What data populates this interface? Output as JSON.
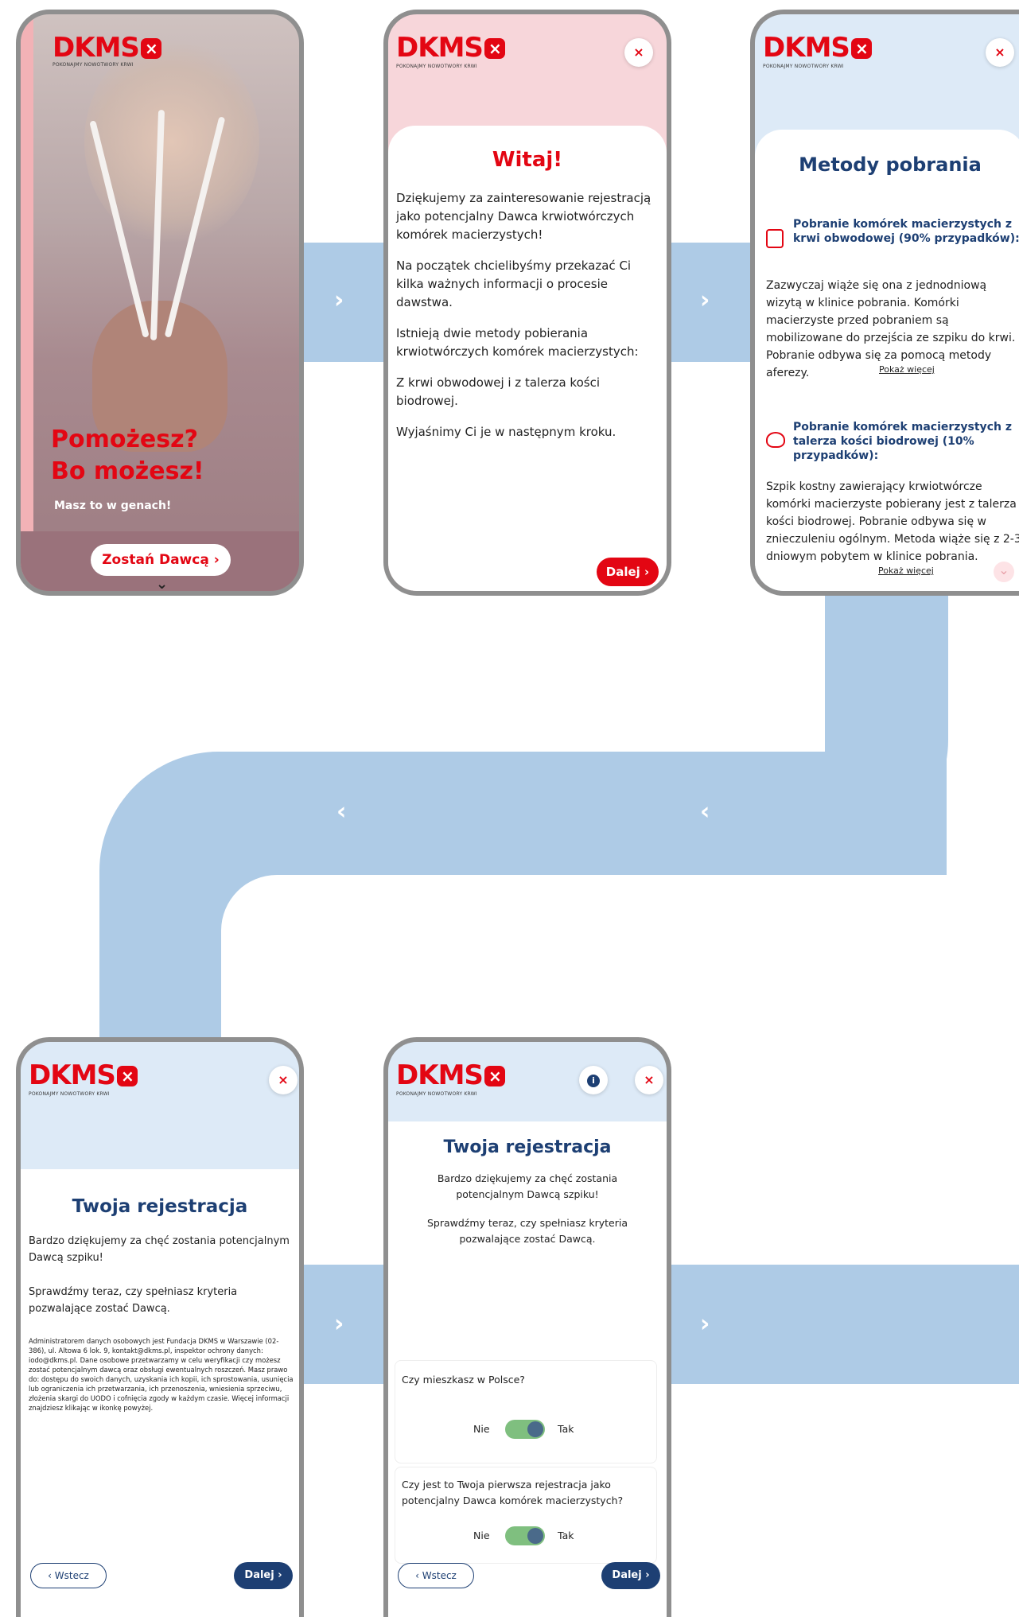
{
  "brand": {
    "logo_text": "DKMS",
    "logo_x": "×",
    "tagline": "POKONAJMY NOWOTWORY KRWI",
    "red": "#e30613",
    "navy": "#1d3f73",
    "flow_blue": "#aecbe6"
  },
  "flow": {
    "next_glyph": "›",
    "prev_glyph": "‹"
  },
  "screen1": {
    "headline": "Pomożesz? Bo możesz!",
    "sub": "Masz to w genach!",
    "cta": "Zostań Dawcą ›",
    "scroll": "⌄"
  },
  "screen2": {
    "close": "×",
    "title": "Witaj!",
    "p1": "Dziękujemy za zainteresowanie rejestracją jako potencjalny Dawca krwiotwórczych komórek macierzystych!",
    "p2": "Na początek chcielibyśmy przekazać Ci kilka ważnych informacji o procesie dawstwa.",
    "p3": "Istnieją dwie metody pobierania krwiotwórczych komórek macierzystych:",
    "p4": "Z krwi obwodowej i z talerza kości biodrowej.",
    "p5": "Wyjaśnimy Ci je w następnym kroku.",
    "next": "Dalej ›"
  },
  "screen3": {
    "close": "×",
    "title": "Metody pobrania",
    "m1_head": "Pobranie komórek macierzystych z krwi obwodowej (90% przypadków):",
    "m1_body": "Zazwyczaj wiąże się ona z jednodniową wizytą w klinice pobrania. Komórki macierzyste przed pobraniem są mobilizowane do przejścia ze szpiku do krwi. Pobranie odbywa się za pomocą metody aferezy.",
    "m1_more": "Pokaż więcej",
    "m2_head": "Pobranie komórek macierzystych z talerza kości biodrowej (10% przypadków):",
    "m2_body": "Szpik kostny zawierający krwiotwórcze komórki macierzyste pobierany jest z talerza kości biodrowej. Pobranie odbywa się w znieczuleniu ogólnym. Metoda wiąże się z 2-3 dniowym pobytem w klinice pobrania.",
    "m2_more": "Pokaż więcej",
    "scroll": "⌄"
  },
  "screen4": {
    "close": "×",
    "title": "Twoja rejestracja",
    "p1": "Bardzo dziękujemy za chęć zostania potencjalnym Dawcą szpiku!",
    "p2": "Sprawdźmy teraz, czy spełniasz kryteria pozwalające zostać Dawcą.",
    "legal": "Administratorem danych osobowych jest Fundacja DKMS w Warszawie (02-386), ul. Altowa 6 lok. 9, kontakt@dkms.pl, inspektor ochrony danych: iodo@dkms.pl. Dane osobowe przetwarzamy w celu weryfikacji czy możesz zostać potencjalnym dawcą oraz obsługi ewentualnych roszczeń. Masz prawo do: dostępu do swoich danych, uzyskania ich kopii, ich sprostowania, usunięcia lub ograniczenia ich przetwarzania, ich przenoszenia, wniesienia sprzeciwu, złożenia skargi do UODO i cofnięcia zgody w każdym czasie. Więcej informacji znajdziesz klikając w ikonkę powyżej.",
    "back": "‹  Wstecz",
    "next": "Dalej ›"
  },
  "screen5": {
    "info": "i",
    "close": "×",
    "title": "Twoja rejestracja",
    "p1": "Bardzo dziękujemy za chęć zostania potencjalnym Dawcą szpiku!",
    "p2": "Sprawdźmy teraz, czy spełniasz kryteria pozwalające zostać Dawcą.",
    "q1": "Czy mieszkasz w Polsce?",
    "q2": "Czy jest to Twoja pierwsza rejestracja jako potencjalny Dawca komórek macierzystych?",
    "no": "Nie",
    "yes": "Tak",
    "back": "‹  Wstecz",
    "next": "Dalej ›"
  }
}
